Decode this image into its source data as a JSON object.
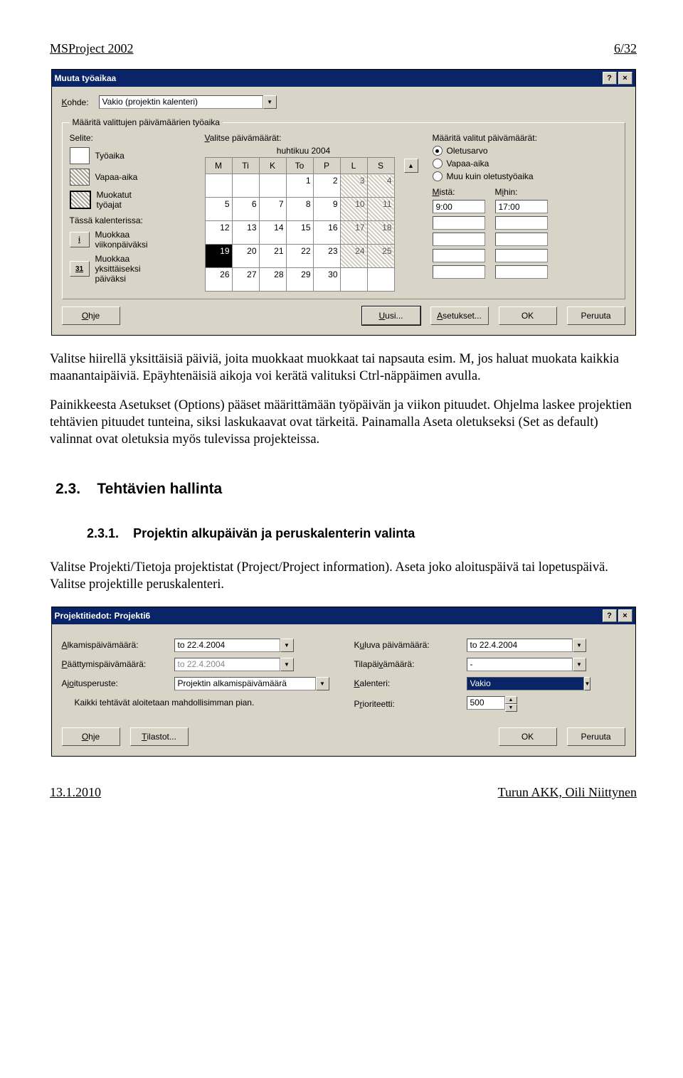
{
  "header": {
    "left": "MSProject 2002",
    "right": "6/32"
  },
  "footer": {
    "left": "13.1.2010",
    "right": "Turun AKK, Oili Niittynen"
  },
  "dialog1": {
    "title": "Muuta työaikaa",
    "kohde_label": "Kohde:",
    "kohde_value": "Vakio (projektin kalenteri)",
    "groupbox": "Määritä valittujen päivämäärien työaika",
    "selite_label": "Selite:",
    "valitse_label": "Valitse päivämäärät:",
    "maarita_label": "Määritä valitut päivämäärät:",
    "legend_items": {
      "tyoaika": "Työaika",
      "vapaa": "Vapaa-aika",
      "muokatut": "Muokatut\ntyöajat"
    },
    "tassa_label": "Tässä kalenterissa:",
    "muokkaa_viikko_icon": "i",
    "muokkaa_viikko": "Muokkaa\nviikonpäiväksi",
    "muokkaa_yksi_icon": "31",
    "muokkaa_yksi": "Muokkaa\nyksittäiseksi\npäiväksi",
    "cal_title": "huhtikuu 2004",
    "cal_days": [
      "M",
      "Ti",
      "K",
      "To",
      "P",
      "L",
      "S"
    ],
    "cal_rows": [
      [
        "",
        "",
        "",
        "1",
        "2",
        "3",
        "4"
      ],
      [
        "5",
        "6",
        "7",
        "8",
        "9",
        "10",
        "11"
      ],
      [
        "12",
        "13",
        "14",
        "15",
        "16",
        "17",
        "18"
      ],
      [
        "19",
        "20",
        "21",
        "22",
        "23",
        "24",
        "25"
      ],
      [
        "26",
        "27",
        "28",
        "29",
        "30",
        "",
        ""
      ]
    ],
    "radio": {
      "oletus": "Oletusarvo",
      "vapaa": "Vapaa-aika",
      "muu": "Muu kuin oletustyöaika"
    },
    "mista_label": "Mistä:",
    "mihin_label": "Mihin:",
    "mista_value": "9:00",
    "mihin_value": "17:00",
    "buttons": {
      "ohje": "Ohje",
      "uusi": "Uusi...",
      "asetukset": "Asetukset...",
      "ok": "OK",
      "peruuta": "Peruuta"
    }
  },
  "body_text": {
    "p1": "Valitse hiirellä yksittäisiä päiviä, joita muokkaat muokkaat tai napsauta esim. M, jos haluat muokata kaikkia maanantaipäiviä. Epäyhtenäisiä aikoja voi kerätä valituksi Ctrl-näppäimen avulla.",
    "p2": "Painikkeesta Asetukset (Options) pääset määrittämään työpäivän ja viikon pituudet. Ohjelma laskee projektien tehtävien pituudet tunteina, siksi laskukaavat ovat tärkeitä. Painamalla Aseta oletukseksi (Set as default) valinnat ovat oletuksia myös tulevissa projekteissa."
  },
  "sec": {
    "num": "2.3.",
    "title": "Tehtävien hallinta"
  },
  "sub": {
    "num": "2.3.1.",
    "title": "Projektin alkupäivän ja peruskalenterin valinta"
  },
  "body_text2": {
    "p": "Valitse Projekti/Tietoja projektistat (Project/Project information). Aseta joko aloituspäivä tai lopetuspäivä. Valitse projektille peruskalenteri."
  },
  "dialog2": {
    "title": "Projektitiedot: Projekti6",
    "alk_label": "Alkamispäivämäärä:",
    "alk_value": "to 22.4.2004",
    "paa_label": "Päättymispäivämäärä:",
    "paa_value": "to 22.4.2004",
    "ajo_label": "Ajoitusperuste:",
    "ajo_value": "Projektin alkamispäivämäärä",
    "kaikki_text": "Kaikki tehtävät aloitetaan mahdollisimman pian.",
    "kuluva_label": "Kuluva päivämäärä:",
    "kuluva_value": "to 22.4.2004",
    "tila_label": "Tilapäivämäärä:",
    "tila_value": "-",
    "kal_label": "Kalenteri:",
    "kal_value": "Vakio",
    "prio_label": "Prioriteetti:",
    "prio_value": "500",
    "buttons": {
      "ohje": "Ohje",
      "tilastot": "Tilastot...",
      "ok": "OK",
      "peruuta": "Peruuta"
    }
  }
}
